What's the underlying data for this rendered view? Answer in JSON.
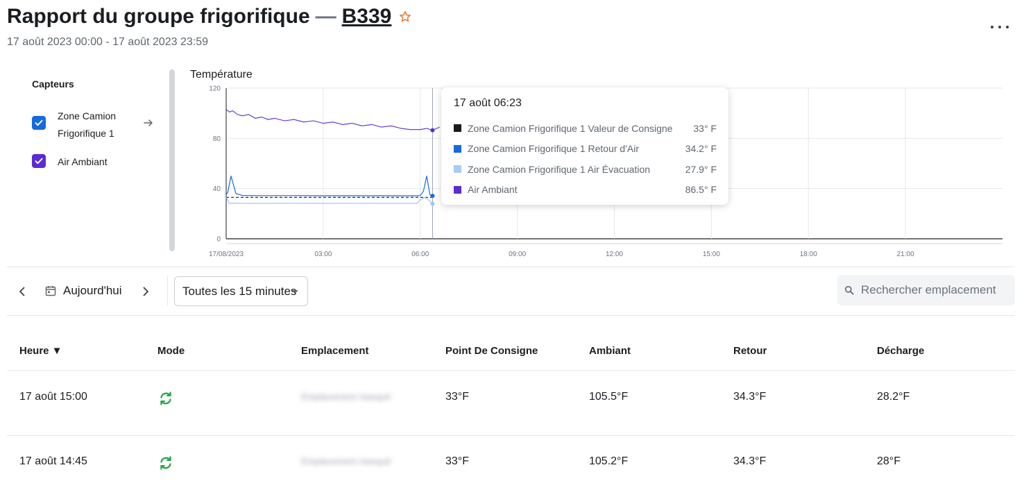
{
  "header": {
    "title": "Rapport du groupe frigorifique",
    "dash": "—",
    "unit_link": "B339",
    "date_range": "17 août 2023 00:00 - 17 août 2023 23:59"
  },
  "sensors": {
    "title": "Capteurs",
    "items": [
      {
        "label": "Zone Camion Frigorifique 1",
        "checked": true,
        "color": "#1668e3"
      },
      {
        "label": "Air Ambiant",
        "checked": true,
        "color": "#5b2bd6"
      }
    ]
  },
  "chart_data": {
    "type": "line",
    "title": "Température",
    "x_tick_labels": [
      "17/08/2023",
      "03:00",
      "06:00",
      "09:00",
      "12:00",
      "15:00",
      "18:00",
      "21:00"
    ],
    "y_ticks": [
      0,
      40,
      80,
      120
    ],
    "ylim": [
      0,
      120
    ],
    "grid": true,
    "series": [
      {
        "name": "Zone Camion Frigorifique 1 Valeur de Consigne",
        "color": "#1a1a1a",
        "style": "dashed",
        "x_hours": [
          0,
          6.4
        ],
        "values": [
          33,
          33
        ]
      },
      {
        "name": "Zone Camion Frigorifique 1 Retour d'Air",
        "color": "#1668e3",
        "x_hours": [
          0,
          0.05,
          0.15,
          0.3,
          0.5,
          1,
          2,
          3,
          4,
          5,
          5.9,
          6.0,
          6.1,
          6.2,
          6.3,
          6.38
        ],
        "values": [
          35,
          37,
          50,
          36,
          34.5,
          34.4,
          34.4,
          34.3,
          34.3,
          34.3,
          34.3,
          34.4,
          38,
          50,
          35,
          34.2
        ]
      },
      {
        "name": "Zone Camion Frigorifique 1 Air Évacuation",
        "color": "#9ec5f5",
        "x_hours": [
          0,
          0.1,
          0.2,
          0.5,
          1,
          2,
          3,
          4,
          5,
          5.9,
          6.0,
          6.15,
          6.3,
          6.38
        ],
        "values": [
          33,
          28,
          28.5,
          28.3,
          28.2,
          28.3,
          28.2,
          28.3,
          28.2,
          28.2,
          31,
          33,
          30,
          27.9
        ]
      },
      {
        "name": "Air Ambiant",
        "color": "#5b2bd6",
        "x_hours": [
          0,
          0.1,
          0.2,
          0.35,
          0.5,
          0.7,
          0.9,
          1.1,
          1.3,
          1.5,
          1.8,
          2.1,
          2.4,
          2.7,
          3.0,
          3.3,
          3.6,
          3.9,
          4.2,
          4.5,
          4.8,
          5.1,
          5.4,
          5.7,
          6.0,
          6.2,
          6.38,
          6.6
        ],
        "values": [
          103,
          101,
          102,
          99,
          98,
          99,
          96,
          97,
          95,
          96,
          94,
          95,
          93,
          94,
          92,
          93,
          91,
          92,
          90,
          91,
          89,
          90,
          88,
          87,
          87,
          88,
          86.5,
          89
        ]
      }
    ]
  },
  "tooltip": {
    "date": "17 août 06:23",
    "rows": [
      {
        "name": "Zone Camion Frigorifique 1 Valeur de Consigne",
        "value": "33° F",
        "color": "#1a1a1a"
      },
      {
        "name": "Zone Camion Frigorifique 1 Retour d'Air",
        "value": "34.2° F",
        "color": "#1668e3"
      },
      {
        "name": "Zone Camion Frigorifique 1 Air Évacuation",
        "value": "27.9° F",
        "color": "#a9cbf7"
      },
      {
        "name": "Air Ambiant",
        "value": "86.5° F",
        "color": "#5b2bd6"
      }
    ]
  },
  "toolbar": {
    "today_label": "Aujourd'hui",
    "interval_value": "Toutes les 15 minutes",
    "search_placeholder": "Rechercher emplacement"
  },
  "table": {
    "headers": [
      "Heure ▼",
      "Mode",
      "Emplacement",
      "Point De Consigne",
      "Ambiant",
      "Retour",
      "Décharge"
    ],
    "rows": [
      {
        "time": "17 août 15:00",
        "mode_icon": "sync-icon",
        "location": "Emplacement masqué",
        "setpoint": "33°F",
        "ambient": "105.5°F",
        "return": "34.3°F",
        "discharge": "28.2°F"
      },
      {
        "time": "17 août 14:45",
        "mode_icon": "sync-icon",
        "location": "Emplacement masqué",
        "setpoint": "33°F",
        "ambient": "105.2°F",
        "return": "34.3°F",
        "discharge": "28°F"
      }
    ]
  },
  "colors": {
    "accent_blue": "#1668e3",
    "accent_purple": "#5b2bd6",
    "star_orange": "#e8742c",
    "mode_green": "#28a745"
  }
}
